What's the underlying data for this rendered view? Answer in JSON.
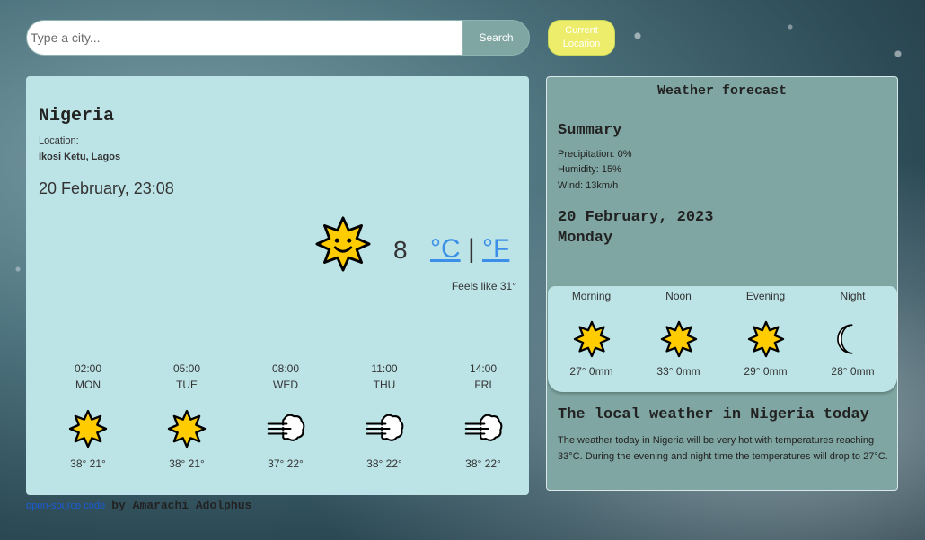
{
  "search": {
    "placeholder": "Type a city...",
    "button_label": "Search",
    "location_button_label": "Current Location"
  },
  "current": {
    "country": "Nigeria",
    "location_label": "Location:",
    "location_value": "Ikosi Ketu, Lagos",
    "datetime": "20 February, 23:08",
    "temperature": "8",
    "unit_c": "°C",
    "unit_separator": "|",
    "unit_f": "°F",
    "feels_like": "Feels like 31°",
    "icon": "sun-icon"
  },
  "hourly": [
    {
      "time": "02:00",
      "day": "MON",
      "icon": "sun-icon",
      "temps": "38° 21°"
    },
    {
      "time": "05:00",
      "day": "TUE",
      "icon": "sun-icon",
      "temps": "38° 21°"
    },
    {
      "time": "08:00",
      "day": "WED",
      "icon": "wind-icon",
      "temps": "37° 22°"
    },
    {
      "time": "11:00",
      "day": "THU",
      "icon": "wind-icon",
      "temps": "38° 22°"
    },
    {
      "time": "14:00",
      "day": "FRI",
      "icon": "wind-icon",
      "temps": "38° 22°"
    }
  ],
  "footer": {
    "link": "open-source code",
    "by": "by Amarachi Adolphus"
  },
  "forecast": {
    "title": "Weather forecast",
    "summary_title": "Summary",
    "precipitation": "Precipitation: 0%",
    "humidity": "Humidity: 15%",
    "wind": "Wind: 13km/h",
    "date": "20 February, 2023",
    "day": "Monday",
    "periods": [
      {
        "name": "Morning",
        "icon": "sun-icon",
        "value": "27° 0mm"
      },
      {
        "name": "Noon",
        "icon": "sun-icon",
        "value": "33° 0mm"
      },
      {
        "name": "Evening",
        "icon": "sun-icon",
        "value": "29° 0mm"
      },
      {
        "name": "Night",
        "icon": "moon-icon",
        "value": "28° 0mm"
      }
    ],
    "local_title": "The local weather in Nigeria today",
    "local_text": "The weather today in Nigeria will be very hot with temperatures reaching 33°C. During the evening and night time the temperatures will drop to 27°C."
  },
  "colors": {
    "card": "#bce3e6",
    "side_card": "#7fa6a2",
    "link": "#3b8fe8",
    "location_button": "#eded6b",
    "sun_fill": "#ffcc00"
  }
}
